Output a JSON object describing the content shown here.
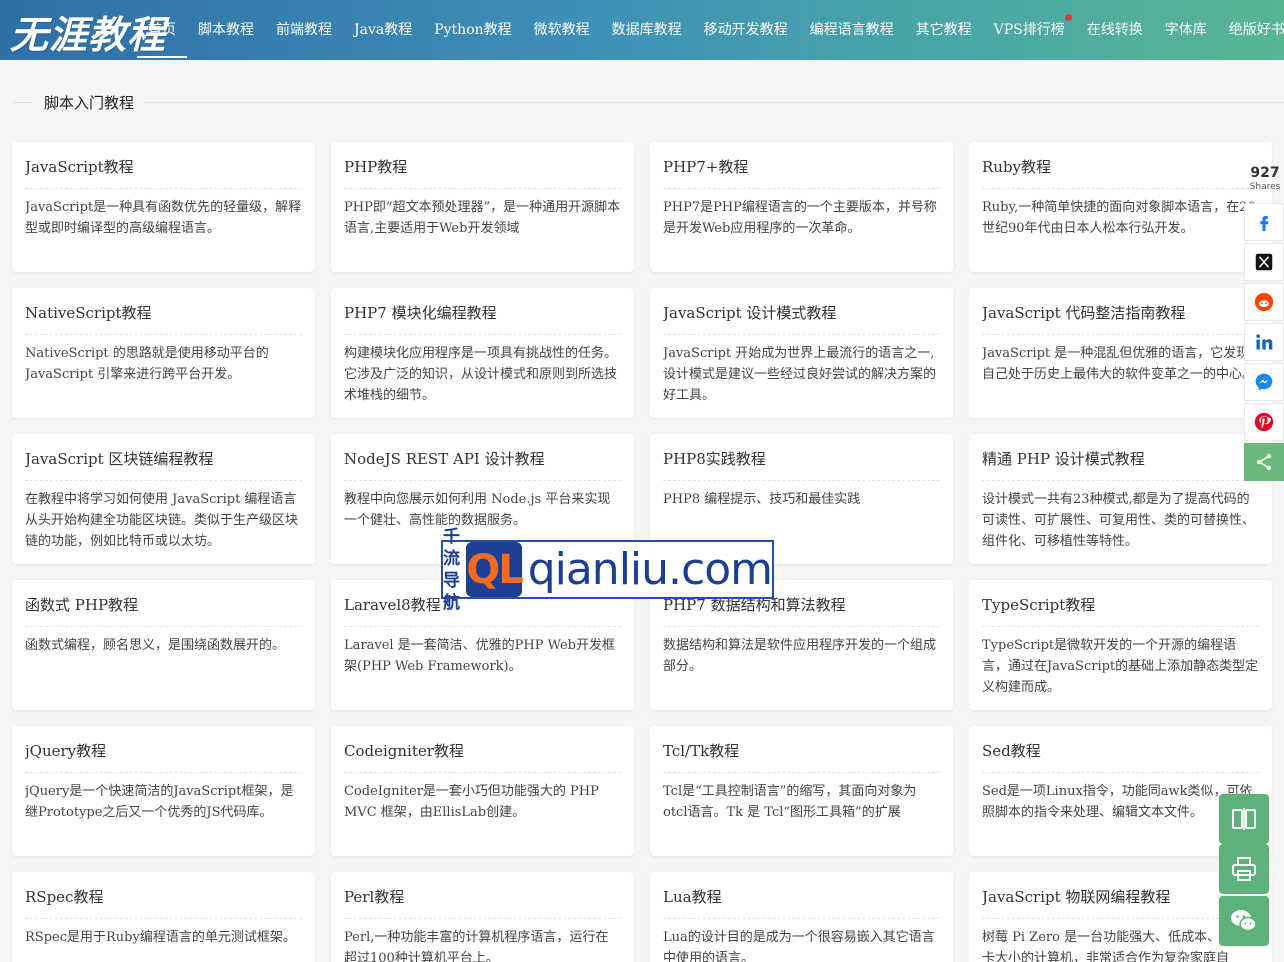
{
  "header": {
    "logo_text": "无涯教程",
    "nav": [
      {
        "label": "首页",
        "active": true
      },
      {
        "label": "脚本教程"
      },
      {
        "label": "前端教程"
      },
      {
        "label": "Java教程"
      },
      {
        "label": "Python教程"
      },
      {
        "label": "微软教程"
      },
      {
        "label": "数据库教程"
      },
      {
        "label": "移动开发教程"
      },
      {
        "label": "编程语言教程"
      },
      {
        "label": "其它教程"
      },
      {
        "label": "VPS排行榜",
        "dot": true
      },
      {
        "label": "在线转换"
      },
      {
        "label": "字体库"
      },
      {
        "label": "绝版好书"
      }
    ]
  },
  "section": {
    "title": "脚本入门教程"
  },
  "cards": [
    {
      "title": "JavaScript教程",
      "desc": "JavaScript是一种具有函数优先的轻量级，解释型或即时编译型的高级编程语言。"
    },
    {
      "title": "PHP教程",
      "desc": "PHP即“超文本预处理器”，是一种通用开源脚本语言,主要适用于Web开发领域"
    },
    {
      "title": "PHP7+教程",
      "desc": "PHP7是PHP编程语言的一个主要版本，并号称是开发Web应用程序的一次革命。"
    },
    {
      "title": "Ruby教程",
      "desc": "Ruby,一种简单快捷的面向对象脚本语言，在20世纪90年代由日本人松本行弘开发。"
    },
    {
      "title": "NativeScript教程",
      "desc": "NativeScript 的思路就是使用移动平台的JavaScript 引擎来进行跨平台开发。"
    },
    {
      "title": "PHP7 模块化编程教程",
      "desc": "构建模块化应用程序是一项具有挑战性的任务。它涉及广泛的知识，从设计模式和原则到所选技术堆栈的细节。"
    },
    {
      "title": "JavaScript 设计模式教程",
      "desc": "JavaScript 开始成为世界上最流行的语言之一,设计模式是建议一些经过良好尝试的解决方案的好工具。"
    },
    {
      "title": "JavaScript 代码整洁指南教程",
      "desc": "JavaScript 是一种混乱但优雅的语言，它发现自己处于历史上最伟大的软件变革之一的中心。"
    },
    {
      "title": "JavaScript 区块链编程教程",
      "desc": "在教程中将学习如何使用 JavaScript 编程语言从头开始构建全功能区块链。类似于生产级区块链的功能，例如比特币或以太坊。"
    },
    {
      "title": "NodeJS REST API 设计教程",
      "desc": "教程中向您展示如何利用 Node.js 平台来实现一个健壮、高性能的数据服务。"
    },
    {
      "title": "PHP8实践教程",
      "desc": "PHP8 编程提示、技巧和最佳实践"
    },
    {
      "title": "精通 PHP 设计模式教程",
      "desc": "设计模式一共有23种模式,都是为了提高代码的可读性、可扩展性、可复用性、类的可替换性、组件化、可移植性等特性。"
    },
    {
      "title": "函数式 PHP教程",
      "desc": "函数式编程，顾名思义，是围绕函数展开的。"
    },
    {
      "title": "Laravel8教程",
      "desc": "Laravel 是一套简洁、优雅的PHP Web开发框架(PHP Web Framework)。"
    },
    {
      "title": "PHP7 数据结构和算法教程",
      "desc": "数据结构和算法是软件应用程序开发的一个组成部分。"
    },
    {
      "title": "TypeScript教程",
      "desc": "TypeScript是微软开发的一个开源的编程语言，通过在JavaScript的基础上添加静态类型定义构建而成。"
    },
    {
      "title": "jQuery教程",
      "desc": "jQuery是一个快速简洁的JavaScript框架，是继Prototype之后又一个优秀的JS代码库。"
    },
    {
      "title": "Codeigniter教程",
      "desc": "CodeIgniter是一套小巧但功能强大的 PHP MVC 框架，由EllisLab创建。"
    },
    {
      "title": "Tcl/Tk教程",
      "desc": "Tcl是“工具控制语言”的缩写，其面向对象为otcl语言。Tk 是 Tcl“图形工具箱”的扩展"
    },
    {
      "title": "Sed教程",
      "desc": "Sed是一项Linux指令，功能同awk类似，可依照脚本的指令来处理、编辑文本文件。"
    },
    {
      "title": "RSpec教程",
      "desc": "RSpec是用于Ruby编程语言的单元测试框架。"
    },
    {
      "title": "Perl教程",
      "desc": "Perl,一种功能丰富的计算机程序语言，运行在超过100种计算机平台上。"
    },
    {
      "title": "Lua教程",
      "desc": "Lua的设计目的是成为一个很容易嵌入其它语言中使用的语言。"
    },
    {
      "title": "JavaScript 物联网编程教程",
      "desc": "树莓 Pi Zero 是一台功能强大、低成本、信用卡大小的计算机，非常适合作为复杂家庭自"
    }
  ],
  "share": {
    "count": "927",
    "label": "Shares",
    "buttons": [
      "facebook-icon",
      "x-icon",
      "reddit-icon",
      "linkedin-icon",
      "messenger-icon",
      "pinterest-icon",
      "share-icon"
    ]
  },
  "watermark": {
    "cn_top": "千流",
    "cn_bottom": "导航",
    "badge": "QL",
    "url": "qianliu.com"
  }
}
